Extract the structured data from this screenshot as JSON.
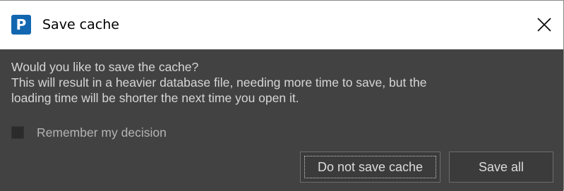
{
  "window": {
    "title": "Save cache",
    "app_icon_letter": "P",
    "icons": {
      "app": "app-logo-icon",
      "close": "close-icon"
    },
    "colors": {
      "app_icon_bg": "#1267b0",
      "dialog_bg": "#424242",
      "text": "#d6d6d6",
      "button_bg": "#3b3b3b",
      "button_border": "#6e6e6e"
    }
  },
  "message": {
    "lines": [
      "Would you like to save the cache?",
      "This will result in a heavier database file, needing more time to save, but the",
      "loading time will be shorter the next time you open it."
    ]
  },
  "remember": {
    "label": "Remember my decision",
    "checked": false
  },
  "buttons": {
    "do_not_save": "Do not save cache",
    "save_all": "Save all"
  }
}
